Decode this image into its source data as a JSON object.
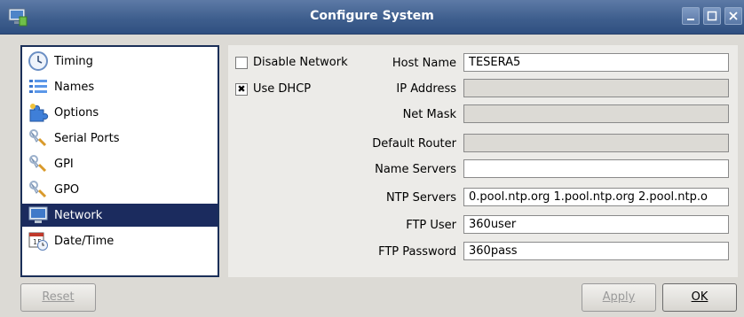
{
  "window": {
    "title": "Configure System"
  },
  "sidebar": {
    "items": [
      {
        "label": "Timing",
        "icon": "clock-icon"
      },
      {
        "label": "Names",
        "icon": "list-icon"
      },
      {
        "label": "Options",
        "icon": "puzzle-icon"
      },
      {
        "label": "Serial Ports",
        "icon": "wrench-icon"
      },
      {
        "label": "GPI",
        "icon": "wrench-icon"
      },
      {
        "label": "GPO",
        "icon": "wrench-icon"
      },
      {
        "label": "Network",
        "icon": "monitor-icon",
        "selected": true
      },
      {
        "label": "Date/Time",
        "icon": "calendar-clock-icon"
      }
    ]
  },
  "network": {
    "disable_network": {
      "label": "Disable Network",
      "checked": false
    },
    "use_dhcp": {
      "label": "Use DHCP",
      "checked": true
    },
    "fields": {
      "host_name": {
        "label": "Host Name",
        "value": "TESERA5"
      },
      "ip_address": {
        "label": "IP Address",
        "value": ""
      },
      "net_mask": {
        "label": "Net Mask",
        "value": ""
      },
      "default_router": {
        "label": "Default Router",
        "value": ""
      },
      "name_servers": {
        "label": "Name Servers",
        "value": ""
      },
      "ntp_servers": {
        "label": "NTP Servers",
        "value": "0.pool.ntp.org  1.pool.ntp.org  2.pool.ntp.o"
      },
      "ftp_user": {
        "label": "FTP User",
        "value": "360user"
      },
      "ftp_password": {
        "label": "FTP Password",
        "value": "360pass"
      }
    }
  },
  "buttons": {
    "reset": "Reset",
    "apply": "Apply",
    "ok": "OK"
  },
  "colors": {
    "titlebar": "#3f5f8e",
    "selection": "#1b2b5e"
  }
}
